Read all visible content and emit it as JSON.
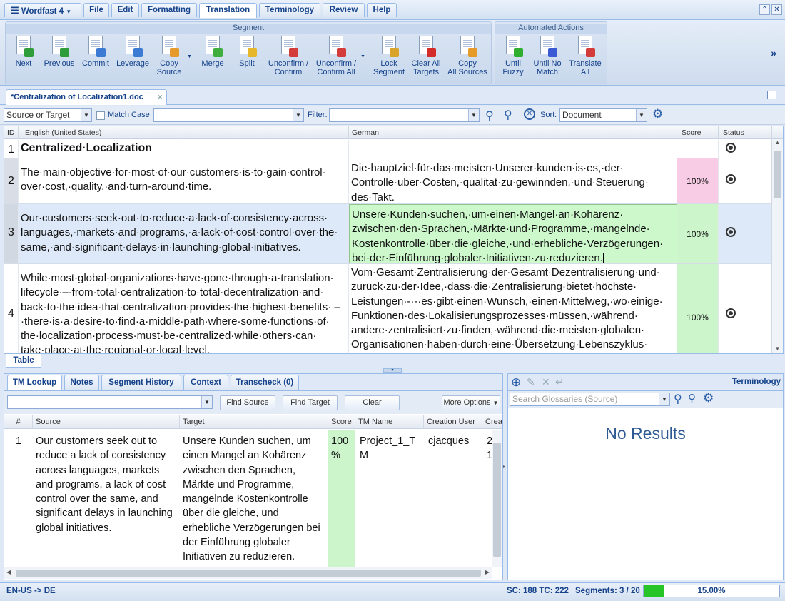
{
  "menu": {
    "app_label": "Wordfast 4",
    "tabs": [
      "File",
      "Edit",
      "Formatting",
      "Translation",
      "Terminology",
      "Review",
      "Help"
    ],
    "active_tab": "Translation"
  },
  "ribbon": {
    "segment_group_title": "Segment",
    "automated_group_title": "Automated Actions",
    "segment_buttons": [
      {
        "line1": "Next",
        "line2": "",
        "icon": "next-icon"
      },
      {
        "line1": "Previous",
        "line2": "",
        "icon": "previous-icon"
      },
      {
        "line1": "Commit",
        "line2": "",
        "icon": "commit-icon"
      },
      {
        "line1": "Leverage",
        "line2": "",
        "icon": "leverage-icon"
      },
      {
        "line1": "Copy",
        "line2": "Source",
        "icon": "copy-source-icon"
      },
      {
        "line1": "Merge",
        "line2": "",
        "icon": "merge-icon"
      },
      {
        "line1": "Split",
        "line2": "",
        "icon": "split-icon"
      },
      {
        "line1": "Unconfirm /",
        "line2": "Confirm",
        "icon": "unconfirm-confirm-icon"
      },
      {
        "line1": "Unconfirm /",
        "line2": "Confirm All",
        "icon": "unconfirm-confirm-all-icon"
      },
      {
        "line1": "Lock",
        "line2": "Segment",
        "icon": "lock-segment-icon"
      },
      {
        "line1": "Clear All",
        "line2": "Targets",
        "icon": "clear-targets-icon"
      },
      {
        "line1": "Copy",
        "line2": "All Sources",
        "icon": "copy-all-sources-icon"
      }
    ],
    "automated_buttons": [
      {
        "line1": "Until",
        "line2": "Fuzzy",
        "icon": "until-fuzzy-icon"
      },
      {
        "line1": "Until No",
        "line2": "Match",
        "icon": "until-no-match-icon"
      },
      {
        "line1": "Translate",
        "line2": "All",
        "icon": "translate-all-icon"
      }
    ],
    "more_glyph": "»"
  },
  "document_tab": {
    "title": "*Centralization of Localization1.doc"
  },
  "filter_bar": {
    "scope_value": "Source or Target",
    "match_case_label": "Match Case",
    "filter_label": "Filter:",
    "sort_label": "Sort:",
    "sort_value": "Document"
  },
  "grid": {
    "headers": {
      "id": "ID",
      "source": "English (United States)",
      "target": "German",
      "score": "Score",
      "status": "Status"
    },
    "rows": [
      {
        "id": "1",
        "source": "Centralized·Localization",
        "target": "",
        "score": ""
      },
      {
        "id": "2",
        "source": "The·main·objective·for·most·of·our·customers·is·to·gain·control· over·cost,·quality,·and·turn-around·time.",
        "target": "Die·hauptziel·für·das·meisten·Unserer·kunden·is·es,·der· Controlle·uber·Costen,·qualitat·zu·gewinnden,·und·Steuerung· des·Takt.",
        "score": "100%"
      },
      {
        "id": "3",
        "source": "Our·customers·seek·out·to·reduce·a·lack·of·consistency·across· languages,·markets·and·programs,·a·lack·of·cost·control·over·the· same,·and·significant·delays·in·launching·global·initiatives.",
        "target": "Unsere·Kunden·suchen,·um·einen·Mangel·an·Kohärenz· zwischen·den·Sprachen,·Märkte·und·Programme,·mangelnde· Kostenkontrolle·über·die·gleiche,·und·erhebliche·Verzögerungen· bei·der·Einführung·globaler·Initiativen·zu·reduzieren.",
        "score": "100%"
      },
      {
        "id": "4",
        "source": "While·most·global·organizations·have·gone·through·a·translation· lifecycle·–·from·total·centralization·to·total·decentralization·and· back·to·the·idea·that·centralization·provides·the·highest·benefits· –·there·is·a·desire·to·find·a·middle·path·where·some·functions·of· the·localization·process·must·be·centralized·while·others·can· take·place·at·the·regional·or·local·level.",
        "target": "Vom·Gesamt·Zentralisierung·der·Gesamt·Dezentralisierung·und· zurück·zu·der·Idee,·dass·die·Zentralisierung·bietet·höchste· Leistungen·-·-·es·gibt·einen·Wunsch,·einen·Mittelweg,·wo·einige· Funktionen·des·Lokalisierungsprozesses·müssen,·während· andere·zentralisiert·zu·finden,·während·die·meisten·globalen· Organisationen·haben·durch·eine·Übersetzung·Lebenszyklus·",
        "score": "100%"
      }
    ],
    "view_tab": "Table"
  },
  "tm_panel": {
    "tabs": [
      "TM Lookup",
      "Notes",
      "Segment History",
      "Context",
      "Transcheck (0)"
    ],
    "active_tab": "TM Lookup",
    "find_source": "Find Source",
    "find_target": "Find Target",
    "clear": "Clear",
    "more_options": "More Options",
    "headers": {
      "num": "#",
      "source": "Source",
      "target": "Target",
      "score": "Score",
      "tm_name": "TM Name",
      "creation_user": "Creation User",
      "creation_date": "Crea"
    },
    "result": {
      "num": "1",
      "source": "Our customers seek out to reduce a lack of consistency across languages, markets and programs, a lack of cost control over the same, and significant delays in launching global initiatives.",
      "target": "Unsere Kunden suchen, um einen Mangel an Kohärenz zwischen den Sprachen, Märkte und Programme, mangelnde Kostenkontrolle über die gleiche, und erhebliche Verzögerungen bei der Einführung globaler Initiativen zu reduzieren.",
      "score": "100 %",
      "tm_name": "Project_1_T M",
      "creation_user": "cjacques",
      "creation_date": "2 1"
    }
  },
  "terminology": {
    "title": "Terminology",
    "search_placeholder": "Search Glossaries (Source)",
    "no_results": "No Results"
  },
  "status": {
    "lang_pair": "EN-US -> DE",
    "counts": "SC: 188 TC: 222",
    "segments": "Segments: 3 / 20",
    "progress_percent": 15,
    "progress_label": "15.00%"
  },
  "colors": {
    "accent": "#15428b",
    "score_pink": "#f8cce4",
    "score_green": "#ccf5cc",
    "target_green": "#ccf8cc",
    "progress_green": "#27c427"
  }
}
